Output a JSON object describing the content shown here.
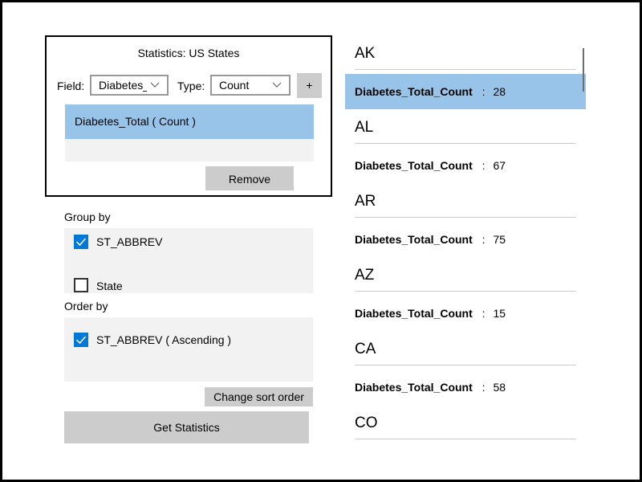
{
  "stats_definition": {
    "title": "Statistics: US States",
    "field_label": "Field:",
    "field_value": "Diabetes_Total",
    "type_label": "Type:",
    "type_value": "Count",
    "add_label": "+",
    "definitions": [
      {
        "text": "Diabetes_Total  ( Count )",
        "selected": true
      }
    ],
    "remove_label": "Remove"
  },
  "group_by": {
    "label": "Group by",
    "fields": [
      {
        "name": "ST_ABBREV",
        "checked": true
      },
      {
        "name": "State",
        "checked": false
      }
    ]
  },
  "order_by": {
    "label": "Order by",
    "fields": [
      {
        "text": "ST_ABBREV  ( Ascending )",
        "checked": true
      }
    ],
    "change_sort_label": "Change sort order"
  },
  "get_statistics_label": "Get Statistics",
  "results": {
    "groups": [
      {
        "key": "AK",
        "stat_name": "Diabetes_Total_Count",
        "separator": ":",
        "value": "28",
        "selected": true
      },
      {
        "key": "AL",
        "stat_name": "Diabetes_Total_Count",
        "separator": ":",
        "value": "67",
        "selected": false
      },
      {
        "key": "AR",
        "stat_name": "Diabetes_Total_Count",
        "separator": ":",
        "value": "75",
        "selected": false
      },
      {
        "key": "AZ",
        "stat_name": "Diabetes_Total_Count",
        "separator": ":",
        "value": "15",
        "selected": false
      },
      {
        "key": "CA",
        "stat_name": "Diabetes_Total_Count",
        "separator": ":",
        "value": "58",
        "selected": false
      },
      {
        "key": "CO",
        "stat_name": "",
        "separator": "",
        "value": "",
        "selected": false
      }
    ]
  },
  "colors": {
    "selection": "#99c4ea",
    "checkbox_accent": "#0078d7",
    "button_gray": "#cccccc",
    "panel_gray": "#f2f2f2"
  }
}
